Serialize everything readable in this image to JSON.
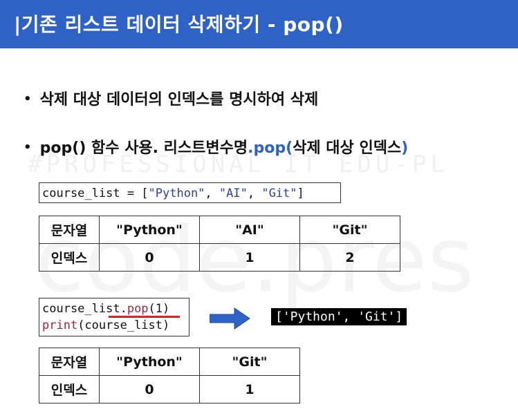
{
  "title": "|기존 리스트 데이터 삭제하기 - pop()",
  "bullets": {
    "b1": "삭제 대상 데이터의 인덱스를 명시하여 삭제",
    "b2_prefix": "pop() 함수 사용. 리스트변수명",
    "b2_method": ".pop(",
    "b2_arg": "삭제 대상 인덱스",
    "b2_close": ")"
  },
  "watermark": "#PROFESSIONAL IT EDU-PL",
  "watermark2": "code.pres",
  "code1": {
    "prefix": "course_list = [",
    "s1": "\"Python\"",
    "sep1": ", ",
    "s2": "\"AI\"",
    "sep2": ", ",
    "s3": "\"Git\"",
    "suffix": "]"
  },
  "table1": {
    "row_label_1": "문자열",
    "row_label_2": "인덱스",
    "values": [
      "\"Python\"",
      "\"AI\"",
      "\"Git\""
    ],
    "indices": [
      "0",
      "1",
      "2"
    ]
  },
  "code2": {
    "line1_obj": "course_list.",
    "line1_fn": "pop",
    "line1_args": "(1)",
    "line2_fn": "print",
    "line2_args": "(course_list)"
  },
  "result": "['Python', 'Git']",
  "table2": {
    "row_label_1": "문자열",
    "row_label_2": "인덱스",
    "values": [
      "\"Python\"",
      "\"Git\""
    ],
    "indices": [
      "0",
      "1"
    ]
  },
  "colors": {
    "accent": "#2f62c7",
    "underline": "#e02020",
    "arrow": "#2f62c7"
  }
}
